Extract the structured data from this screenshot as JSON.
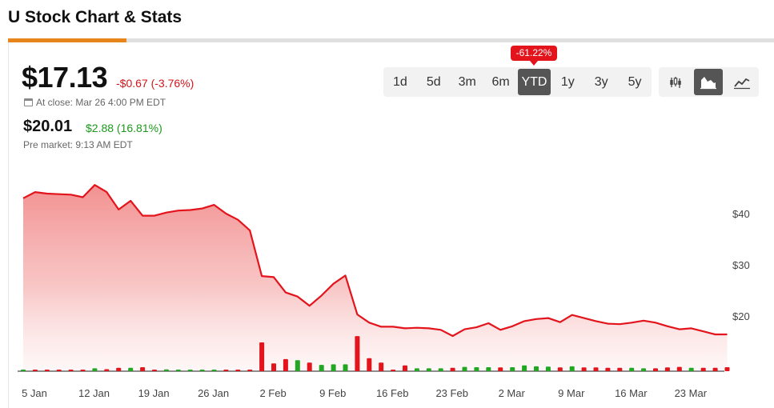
{
  "page": {
    "title": "U Stock Chart & Stats"
  },
  "quote": {
    "price": "$17.13",
    "change": "-$0.67 (-3.76%)",
    "close_info": "At close: Mar 26 4:00 PM EDT",
    "premarket_price": "$20.01",
    "premarket_change": "$2.88 (16.81%)",
    "premarket_info": "Pre market: 9:13 AM EDT"
  },
  "range_selector": {
    "options": [
      "1d",
      "5d",
      "3m",
      "6m",
      "YTD",
      "1y",
      "3y",
      "5y"
    ],
    "selected": "YTD",
    "badge": "-61.22%"
  },
  "chart_type_selector": {
    "options": [
      "candlestick-icon",
      "area-chart-icon",
      "line-chart-icon"
    ],
    "selected": "area-chart-icon"
  },
  "colors": {
    "down": "#e3141c",
    "up": "#22a722",
    "accent": "#e8851a",
    "active_button": "#555555"
  },
  "chart_data": {
    "type": "area",
    "x_ticks": [
      "5 Jan",
      "12 Jan",
      "19 Jan",
      "26 Jan",
      "2 Feb",
      "9 Feb",
      "16 Feb",
      "23 Feb",
      "2 Mar",
      "9 Mar",
      "16 Mar",
      "23 Mar"
    ],
    "y_ticks": [
      "$40",
      "$30",
      "$20"
    ],
    "y_tick_values": [
      40,
      30,
      20
    ],
    "ylim": [
      9.5,
      44
    ],
    "x_range": [
      0,
      58.6
    ],
    "price_series": [
      {
        "x": 0,
        "y": 43.0
      },
      {
        "x": 1,
        "y": 44.2
      },
      {
        "x": 2,
        "y": 43.9
      },
      {
        "x": 3,
        "y": 43.8
      },
      {
        "x": 4,
        "y": 43.7
      },
      {
        "x": 5,
        "y": 43.2
      },
      {
        "x": 6,
        "y": 45.6
      },
      {
        "x": 7,
        "y": 44.2
      },
      {
        "x": 8,
        "y": 40.8
      },
      {
        "x": 9,
        "y": 42.5
      },
      {
        "x": 10,
        "y": 39.6
      },
      {
        "x": 11,
        "y": 39.6
      },
      {
        "x": 12,
        "y": 40.2
      },
      {
        "x": 13,
        "y": 40.6
      },
      {
        "x": 14,
        "y": 40.7
      },
      {
        "x": 15,
        "y": 41.0
      },
      {
        "x": 16,
        "y": 41.7
      },
      {
        "x": 17,
        "y": 40.0
      },
      {
        "x": 18,
        "y": 38.8
      },
      {
        "x": 19,
        "y": 36.7
      },
      {
        "x": 20,
        "y": 27.8
      },
      {
        "x": 21,
        "y": 27.6
      },
      {
        "x": 22,
        "y": 24.6
      },
      {
        "x": 23,
        "y": 23.8
      },
      {
        "x": 24,
        "y": 22.0
      },
      {
        "x": 25,
        "y": 24.0
      },
      {
        "x": 26,
        "y": 26.3
      },
      {
        "x": 27,
        "y": 27.9
      },
      {
        "x": 28,
        "y": 20.3
      },
      {
        "x": 29,
        "y": 18.7
      },
      {
        "x": 30,
        "y": 17.9
      },
      {
        "x": 31,
        "y": 17.9
      },
      {
        "x": 32,
        "y": 17.6
      },
      {
        "x": 33,
        "y": 17.7
      },
      {
        "x": 34,
        "y": 17.6
      },
      {
        "x": 35,
        "y": 17.3
      },
      {
        "x": 36,
        "y": 16.1
      },
      {
        "x": 37,
        "y": 17.4
      },
      {
        "x": 38,
        "y": 17.8
      },
      {
        "x": 39,
        "y": 18.6
      },
      {
        "x": 40,
        "y": 17.3
      },
      {
        "x": 41,
        "y": 18.0
      },
      {
        "x": 42,
        "y": 19.0
      },
      {
        "x": 43,
        "y": 19.4
      },
      {
        "x": 44,
        "y": 19.6
      },
      {
        "x": 45,
        "y": 18.8
      },
      {
        "x": 46,
        "y": 20.2
      },
      {
        "x": 47,
        "y": 19.6
      },
      {
        "x": 48,
        "y": 19.0
      },
      {
        "x": 49,
        "y": 18.5
      },
      {
        "x": 50,
        "y": 18.4
      },
      {
        "x": 51,
        "y": 18.7
      },
      {
        "x": 52,
        "y": 19.1
      },
      {
        "x": 53,
        "y": 18.7
      },
      {
        "x": 54,
        "y": 18.0
      },
      {
        "x": 55,
        "y": 17.4
      },
      {
        "x": 56,
        "y": 17.6
      },
      {
        "x": 57,
        "y": 17.0
      },
      {
        "x": 58,
        "y": 16.4
      },
      {
        "x": 59,
        "y": 16.4
      }
    ],
    "volume_series": [
      {
        "x": 0,
        "v": 0.04,
        "dir": "up"
      },
      {
        "x": 1,
        "v": 0.03,
        "dir": "down"
      },
      {
        "x": 2,
        "v": 0.03,
        "dir": "down"
      },
      {
        "x": 3,
        "v": 0.03,
        "dir": "down"
      },
      {
        "x": 4,
        "v": 0.03,
        "dir": "down"
      },
      {
        "x": 5,
        "v": 0.03,
        "dir": "down"
      },
      {
        "x": 6,
        "v": 0.1,
        "dir": "up"
      },
      {
        "x": 7,
        "v": 0.07,
        "dir": "down"
      },
      {
        "x": 8,
        "v": 0.12,
        "dir": "down"
      },
      {
        "x": 9,
        "v": 0.12,
        "dir": "up"
      },
      {
        "x": 10,
        "v": 0.14,
        "dir": "down"
      },
      {
        "x": 11,
        "v": 0.03,
        "dir": "down"
      },
      {
        "x": 12,
        "v": 0.06,
        "dir": "up"
      },
      {
        "x": 13,
        "v": 0.04,
        "dir": "up"
      },
      {
        "x": 14,
        "v": 0.03,
        "dir": "up"
      },
      {
        "x": 15,
        "v": 0.04,
        "dir": "up"
      },
      {
        "x": 16,
        "v": 0.04,
        "dir": "up"
      },
      {
        "x": 17,
        "v": 0.03,
        "dir": "down"
      },
      {
        "x": 18,
        "v": 0.05,
        "dir": "down"
      },
      {
        "x": 19,
        "v": 0.03,
        "dir": "down"
      },
      {
        "x": 20,
        "v": 1.0,
        "dir": "down"
      },
      {
        "x": 21,
        "v": 0.27,
        "dir": "down"
      },
      {
        "x": 22,
        "v": 0.42,
        "dir": "down"
      },
      {
        "x": 23,
        "v": 0.38,
        "dir": "up"
      },
      {
        "x": 24,
        "v": 0.3,
        "dir": "down"
      },
      {
        "x": 25,
        "v": 0.22,
        "dir": "up"
      },
      {
        "x": 26,
        "v": 0.24,
        "dir": "up"
      },
      {
        "x": 27,
        "v": 0.24,
        "dir": "up"
      },
      {
        "x": 28,
        "v": 1.22,
        "dir": "down"
      },
      {
        "x": 29,
        "v": 0.45,
        "dir": "down"
      },
      {
        "x": 30,
        "v": 0.3,
        "dir": "down"
      },
      {
        "x": 31,
        "v": 0.03,
        "dir": "down"
      },
      {
        "x": 32,
        "v": 0.2,
        "dir": "down"
      },
      {
        "x": 33,
        "v": 0.1,
        "dir": "up"
      },
      {
        "x": 34,
        "v": 0.1,
        "dir": "up"
      },
      {
        "x": 35,
        "v": 0.1,
        "dir": "up"
      },
      {
        "x": 36,
        "v": 0.12,
        "dir": "down"
      },
      {
        "x": 37,
        "v": 0.15,
        "dir": "up"
      },
      {
        "x": 38,
        "v": 0.14,
        "dir": "up"
      },
      {
        "x": 39,
        "v": 0.14,
        "dir": "up"
      },
      {
        "x": 40,
        "v": 0.13,
        "dir": "down"
      },
      {
        "x": 41,
        "v": 0.14,
        "dir": "up"
      },
      {
        "x": 42,
        "v": 0.2,
        "dir": "up"
      },
      {
        "x": 43,
        "v": 0.17,
        "dir": "up"
      },
      {
        "x": 44,
        "v": 0.16,
        "dir": "up"
      },
      {
        "x": 45,
        "v": 0.13,
        "dir": "down"
      },
      {
        "x": 46,
        "v": 0.17,
        "dir": "up"
      },
      {
        "x": 47,
        "v": 0.13,
        "dir": "down"
      },
      {
        "x": 48,
        "v": 0.13,
        "dir": "down"
      },
      {
        "x": 49,
        "v": 0.12,
        "dir": "down"
      },
      {
        "x": 50,
        "v": 0.12,
        "dir": "down"
      },
      {
        "x": 51,
        "v": 0.12,
        "dir": "up"
      },
      {
        "x": 52,
        "v": 0.1,
        "dir": "up"
      },
      {
        "x": 53,
        "v": 0.1,
        "dir": "down"
      },
      {
        "x": 54,
        "v": 0.13,
        "dir": "down"
      },
      {
        "x": 55,
        "v": 0.15,
        "dir": "down"
      },
      {
        "x": 56,
        "v": 0.12,
        "dir": "up"
      },
      {
        "x": 57,
        "v": 0.12,
        "dir": "down"
      },
      {
        "x": 58,
        "v": 0.12,
        "dir": "down"
      },
      {
        "x": 59,
        "v": 0.14,
        "dir": "down"
      }
    ],
    "grid": false,
    "legend": "none"
  }
}
